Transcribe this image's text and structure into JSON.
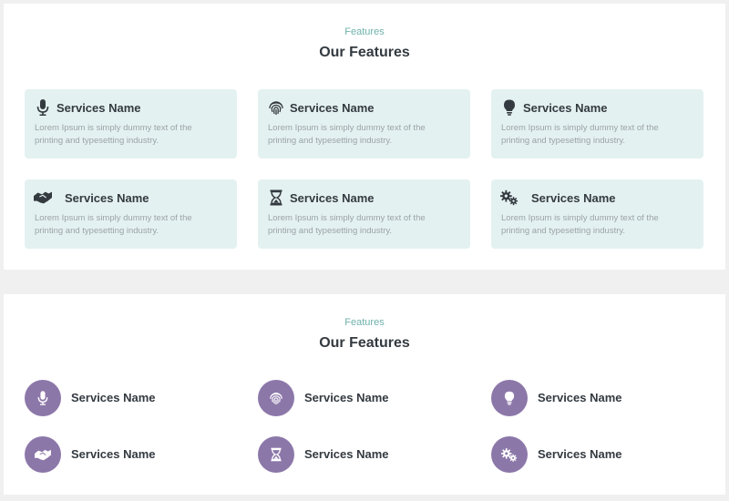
{
  "section_cards": {
    "eyebrow": "Features",
    "heading": "Our Features",
    "items": [
      {
        "icon": "microphone-icon",
        "title": "Services Name",
        "desc": "Lorem Ipsum is simply dummy text of the printing and typesetting industry."
      },
      {
        "icon": "fingerprint-icon",
        "title": "Services Name",
        "desc": "Lorem Ipsum is simply dummy text of the printing and typesetting industry."
      },
      {
        "icon": "lightbulb-icon",
        "title": "Services Name",
        "desc": "Lorem Ipsum is simply dummy text of the printing and typesetting industry."
      },
      {
        "icon": "handshake-icon",
        "title": "Services Name",
        "desc": "Lorem Ipsum is simply dummy text of the printing and typesetting industry."
      },
      {
        "icon": "hourglass-icon",
        "title": "Services Name",
        "desc": "Lorem Ipsum is simply dummy text of the printing and typesetting industry."
      },
      {
        "icon": "gears-icon",
        "title": "Services Name",
        "desc": "Lorem Ipsum is simply dummy text of the printing and typesetting industry."
      }
    ]
  },
  "section_circles": {
    "eyebrow": "Features",
    "heading": "Our Features",
    "items": [
      {
        "icon": "microphone-icon",
        "title": "Services Name"
      },
      {
        "icon": "fingerprint-icon",
        "title": "Services Name"
      },
      {
        "icon": "lightbulb-icon",
        "title": "Services Name"
      },
      {
        "icon": "handshake-icon",
        "title": "Services Name"
      },
      {
        "icon": "hourglass-icon",
        "title": "Services Name"
      },
      {
        "icon": "gears-icon",
        "title": "Services Name"
      }
    ]
  },
  "colors": {
    "accent_teal": "#6fb1ac",
    "card_bg": "#e4f1f1",
    "circle_purple": "#8c77a9",
    "heading_text": "#333a40",
    "body_text": "#9aa3a6"
  }
}
